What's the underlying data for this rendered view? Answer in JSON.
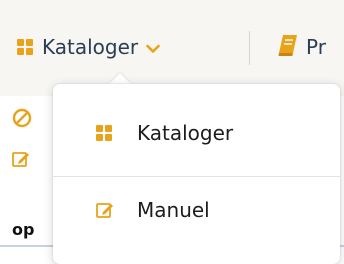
{
  "topnav": {
    "kataloger_label": "Kataloger",
    "other_label_partial": "Pr"
  },
  "dropdown": {
    "items": [
      {
        "label": "Kataloger",
        "icon": "grid-icon"
      },
      {
        "label": "Manuel",
        "icon": "edit-icon"
      }
    ]
  },
  "background": {
    "peek_label": "op"
  },
  "colors": {
    "accent": "#e8a31b",
    "nav_text": "#2a3d55",
    "error_icon": "#e8a31b"
  }
}
